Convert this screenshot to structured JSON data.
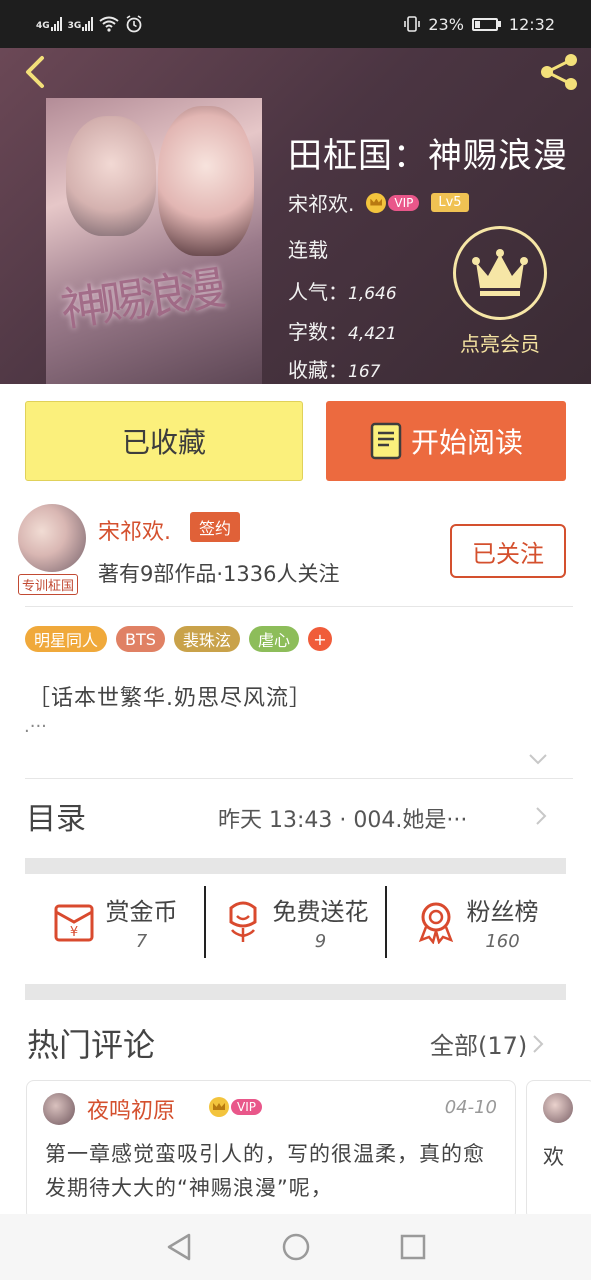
{
  "status_bar": {
    "net1": "4G",
    "net2": "3G",
    "battery_pct": "23%",
    "time": "12:32"
  },
  "header": {
    "book_title": "田柾国：神赐浪漫",
    "author": "宋祁欢.",
    "vip_label": "VIP",
    "level": "Lv5",
    "status": "连载",
    "popularity_label": "人气：",
    "popularity": "1,646",
    "word_count_label": "字数：",
    "word_count": "4,421",
    "favorites_label": "收藏：",
    "favorites": "167",
    "member_label": "点亮会员",
    "cover_art_text": "神赐浪漫"
  },
  "buttons": {
    "collected": "已收藏",
    "start_reading": "开始阅读"
  },
  "author_card": {
    "name": "宋祁欢.",
    "sign_badge": "签约",
    "avatar_tag": "专训柾国",
    "stats": "著有9部作品·1336人关注",
    "follow_label": "已关注"
  },
  "tags": [
    {
      "label": "明星同人",
      "color": "#f0a93b"
    },
    {
      "label": "BTS",
      "color": "#e08164"
    },
    {
      "label": "裴珠泫",
      "color": "#c9a24a"
    },
    {
      "label": "虐心",
      "color": "#8dbd5a"
    }
  ],
  "tag_more": "+",
  "intro": {
    "text": "［话本世繁华.奶思尽风流］",
    "more": ".···"
  },
  "catalog": {
    "title": "目录",
    "info": "昨天  13:43 · 004.她是···"
  },
  "actions": [
    {
      "label": "赏金币",
      "count": "7",
      "icon": "red-envelope-icon"
    },
    {
      "label": "免费送花",
      "count": "9",
      "icon": "flower-icon"
    },
    {
      "label": "粉丝榜",
      "count": "160",
      "icon": "ribbon-medal-icon"
    }
  ],
  "comments": {
    "title": "热门评论",
    "all_label": "全部(17)",
    "items": [
      {
        "user": "夜鸣初原",
        "vip": "VIP",
        "date": "04-10",
        "text": "第一章感觉蛮吸引人的，写的很温柔，真的愈发期待大大的“神赐浪漫”呢，"
      },
      {
        "text": "欢"
      }
    ]
  },
  "colors": {
    "accent_orange": "#ec6a3f",
    "author_red": "#d4502e",
    "collected_yellow": "#fbf07c",
    "member_gold": "#f4e2a0"
  }
}
